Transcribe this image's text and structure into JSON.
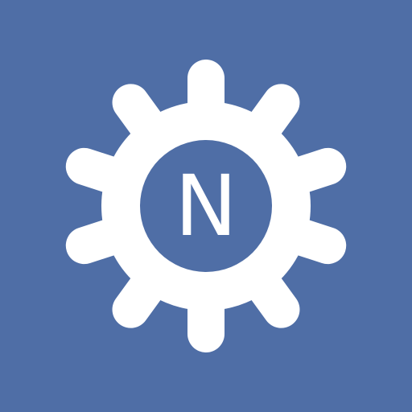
{
  "app_icon": {
    "letter": "N",
    "icon": "ship-wheel-gear-icon",
    "colors": {
      "background": "#4f6ea6",
      "wheel": "#ffffff",
      "hub": "#4f6ea6",
      "letter": "#ffffff"
    }
  }
}
